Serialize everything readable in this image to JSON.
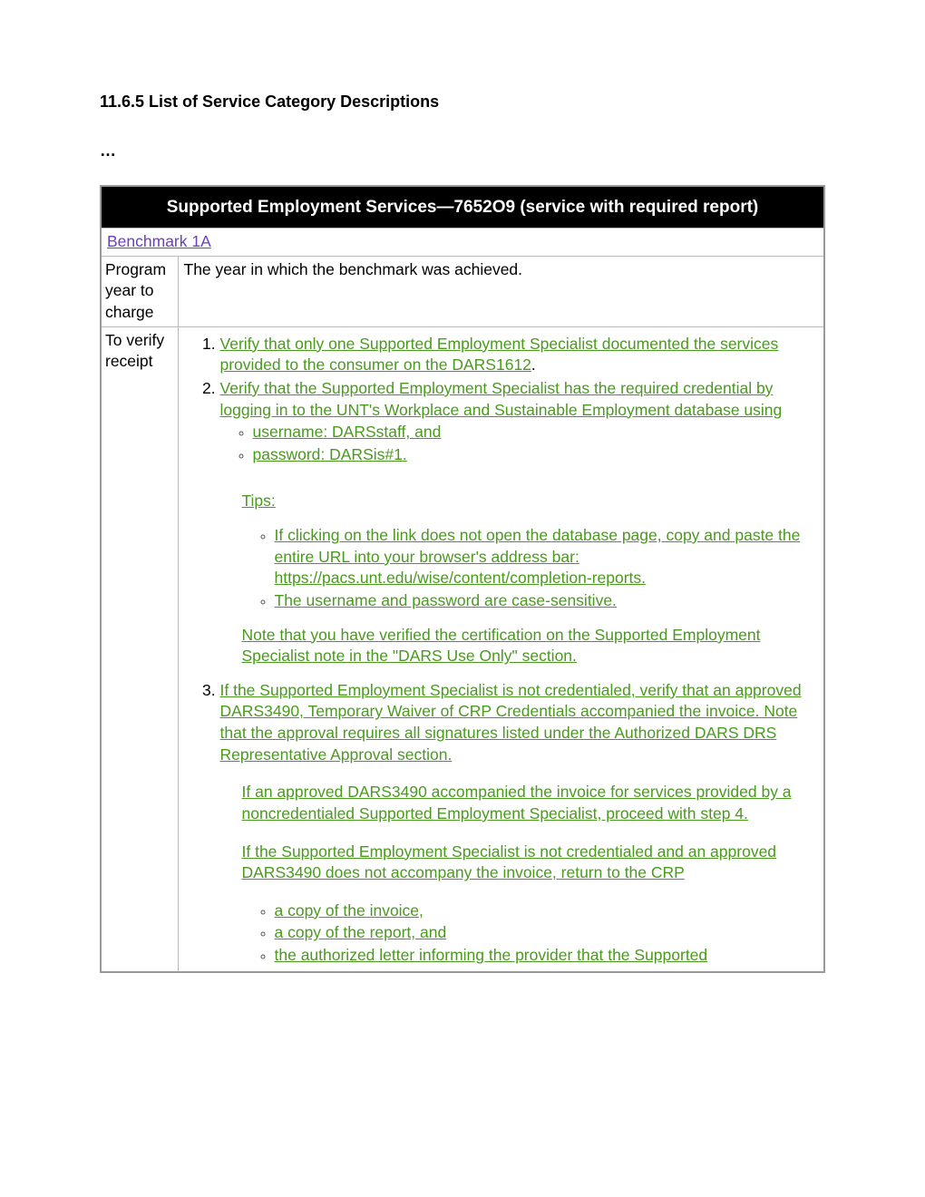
{
  "heading": "11.6.5 List of Service Category Descriptions",
  "ellipsis": "…",
  "table_header": "Supported Employment Services—7652O9 (service with required report)",
  "benchmark_link": "Benchmark 1A",
  "row_program_label": "Program year to charge",
  "row_program_value": "The year in which the benchmark was achieved.",
  "row_verify_label": "To verify receipt",
  "verify": {
    "item1": "Verify that only one Supported Employment Specialist documented the services provided to the consumer on the DARS1612",
    "item1_tail": ".",
    "item2_lead": "Verify that the Supported Employment Specialist has the required credential by logging in to the UNT's Workplace and Sustainable Employment database using ",
    "item2_sub_a": "username: DARSstaff, and",
    "item2_sub_b": "password: DARSis#1. ",
    "tips_label": "Tips:",
    "tips_sub_a_pre": "If clicking on the link does not open the database page, copy and paste the entire URL into your browser's address bar: ",
    "tips_sub_a_url": "https://pacs.unt.edu/wise/content/completion-reports. ",
    "tips_sub_b": "The username and password are case-sensitive. ",
    "note": "Note that you have verified the certification on the Supported Employment Specialist note in the \"DARS Use Only\" section.",
    "item3": "If the Supported Employment Specialist is not credentialed, verify that an approved DARS3490, Temporary Waiver of CRP Credentials accompanied the invoice. Note that the approval requires all signatures listed under the Authorized DARS DRS Representative Approval section.",
    "after3_p1": "If an approved DARS3490 accompanied the invoice for services provided by a noncredentialed Supported Employment Specialist, proceed with step 4.",
    "after3_p2": "If the Supported Employment Specialist is not credentialed and an approved DARS3490 does not accompany the invoice, return to the CRP",
    "after3_sub_a": "a copy of the invoice",
    "after3_sub_a_tail": ", ",
    "after3_sub_b": "a copy of the report, and ",
    "after3_sub_c": "the authorized letter informing the provider that the Supported"
  }
}
